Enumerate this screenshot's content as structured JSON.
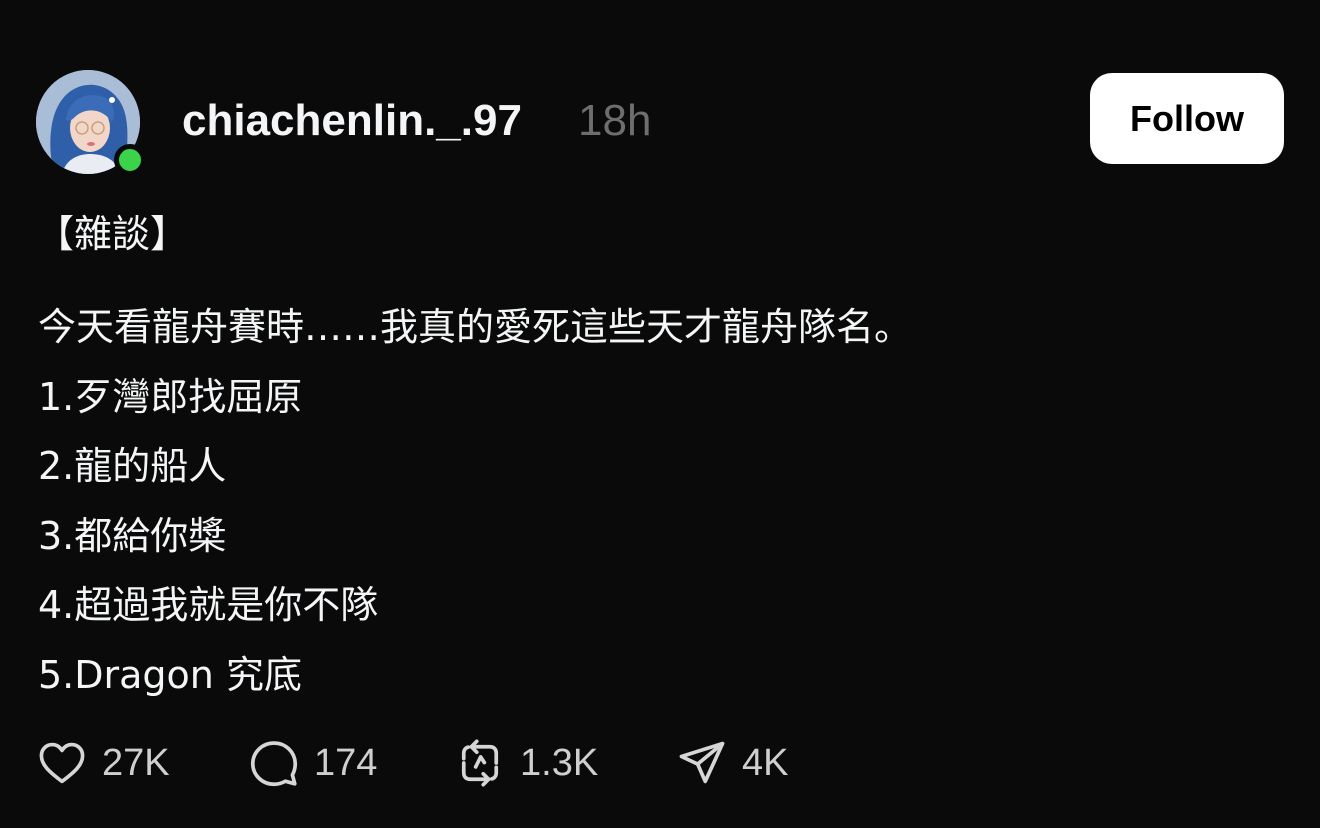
{
  "post": {
    "username": "chiachenlin._.97",
    "time": "18h",
    "follow_label": "Follow",
    "tag": "【雜談】",
    "lines": [
      "今天看龍舟賽時……我真的愛死這些天才龍舟隊名。",
      "1.歹灣郎找屈原",
      "2.龍的船人",
      "3.都給你槳",
      "4.超過我就是你不隊",
      "5.Dragon 究底"
    ],
    "actions": {
      "likes": "27K",
      "replies": "174",
      "reposts": "1.3K",
      "shares": "4K"
    },
    "icons": {
      "like": "heart-icon",
      "reply": "speech-bubble-icon",
      "repost": "repost-icon",
      "share": "paper-plane-icon"
    },
    "colors": {
      "background": "#0a0a0a",
      "text": "#f3f5f7",
      "muted": "#6e6e6e",
      "online": "#3bd34a",
      "button_bg": "#ffffff",
      "button_text": "#000000"
    }
  }
}
